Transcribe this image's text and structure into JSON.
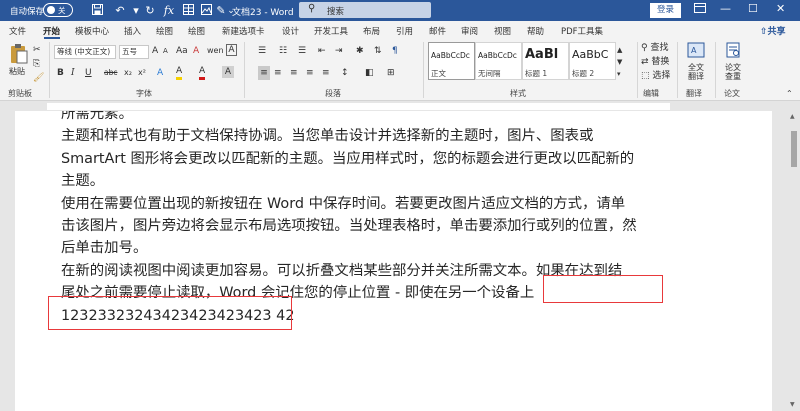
{
  "titlebar": {
    "autosave_label": "自动保存",
    "autosave_state": "关",
    "doc_title": "文档23 - Word",
    "search_placeholder": "搜索",
    "login_label": "登录",
    "quick_access": [
      "save-icon",
      "undo-icon",
      "redo-icon",
      "formula-icon",
      "table-icon",
      "image-icon",
      "paint-icon",
      "more-icon"
    ],
    "window_controls": [
      "ribbon-display-icon",
      "minimize-icon",
      "restore-icon",
      "close-icon"
    ]
  },
  "tabs": {
    "items": [
      "文件",
      "开始",
      "模板中心",
      "插入",
      "绘图",
      "绘图",
      "新建选项卡",
      "设计",
      "开发工具",
      "布局",
      "引用",
      "邮件",
      "审阅",
      "视图",
      "帮助",
      "PDF工具集"
    ],
    "active": "开始",
    "share_label": "共享"
  },
  "ribbon": {
    "clipboard": {
      "paste_label": "粘贴",
      "group_label": "剪贴板"
    },
    "font": {
      "font_name": "等线 (中文正文)",
      "font_size": "五号",
      "group_label": "字体",
      "buttons_row1": [
        "A",
        "A",
        "Aa",
        "A",
        "wen",
        "A"
      ],
      "buttons_row2": [
        "B",
        "I",
        "U",
        "abc",
        "x₂",
        "x²",
        "A",
        "A",
        "A",
        "A"
      ]
    },
    "paragraph": {
      "group_label": "段落"
    },
    "styles": {
      "group_label": "样式",
      "items": [
        {
          "preview": "AaBbCcDc",
          "name": "正文"
        },
        {
          "preview": "AaBbCcDc",
          "name": "无间隔"
        },
        {
          "preview": "AaBl",
          "name": "标题 1"
        },
        {
          "preview": "AaBbC",
          "name": "标题 2"
        }
      ]
    },
    "editing": {
      "group_label": "编辑",
      "items": [
        "查找",
        "替换",
        "选择"
      ]
    },
    "translate": {
      "button_label": "全文\n翻译",
      "group_label": "翻译"
    },
    "paper": {
      "button_label": "论文\n查重",
      "group_label": "论文"
    }
  },
  "document": {
    "lines": [
      "所需元素。",
      "主题和样式也有助于文档保持协调。当您单击设计并选择新的主题时，图片、图表或",
      "SmartArt 图形将会更改以匹配新的主题。当应用样式时，您的标题会进行更改以匹配新的",
      "主题。",
      "使用在需要位置出现的新按钮在 Word 中保存时间。若要更改图片适应文档的方式，请单",
      "击该图片，图片旁边将会显示布局选项按钮。当处理表格时，单击要添加行或列的位置，然",
      "后单击加号。",
      "在新的阅读视图中阅读更加容易。可以折叠文档某些部分并关注所需文本。如果在达到结",
      "尾处之前需要停止读取，Word 会记住您的停止位置 - 即使在另一个设备上",
      "12323323243423423423423 42"
    ]
  },
  "colors": {
    "accent": "#2b579a",
    "highlight_box": "#e8393b"
  }
}
